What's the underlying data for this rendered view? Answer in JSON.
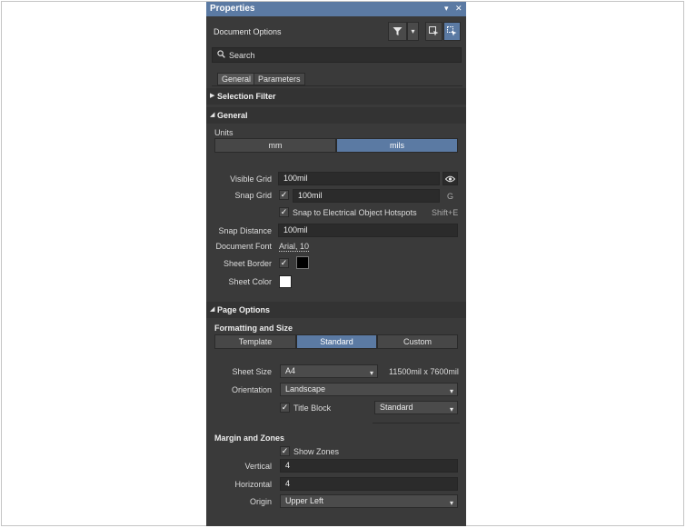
{
  "window": {
    "title": "Properties",
    "pin_icon": "pin-icon",
    "close_icon": "close-icon"
  },
  "header": {
    "subtitle": "Document Options"
  },
  "search": {
    "placeholder": "Search"
  },
  "tabs": [
    {
      "label": "General"
    },
    {
      "label": "Parameters"
    }
  ],
  "sections": {
    "selection_filter": "Selection Filter",
    "general": "General",
    "page_options": "Page Options"
  },
  "general": {
    "units_label": "Units",
    "units_options": [
      "mm",
      "mils"
    ],
    "units_selected": "mils",
    "visible_grid_label": "Visible Grid",
    "visible_grid_value": "100mil",
    "snap_grid_label": "Snap Grid",
    "snap_grid_checked": true,
    "snap_grid_value": "100mil",
    "snap_grid_shortcut": "G",
    "snap_hotspots_label": "Snap to Electrical Object Hotspots",
    "snap_hotspots_checked": true,
    "snap_hotspots_shortcut": "Shift+E",
    "snap_distance_label": "Snap Distance",
    "snap_distance_value": "100mil",
    "document_font_label": "Document Font",
    "document_font_value": "Arial, 10",
    "sheet_border_label": "Sheet Border",
    "sheet_border_checked": true,
    "sheet_border_color": "#000000",
    "sheet_color_label": "Sheet Color",
    "sheet_color": "#ffffff"
  },
  "page_options": {
    "formatting_label": "Formatting and Size",
    "format_options": [
      "Template",
      "Standard",
      "Custom"
    ],
    "format_selected": "Standard",
    "sheet_size_label": "Sheet Size",
    "sheet_size_value": "A4",
    "sheet_size_dims": "11500mil x 7600mil",
    "orientation_label": "Orientation",
    "orientation_value": "Landscape",
    "title_block_label": "Title Block",
    "title_block_checked": true,
    "title_block_value": "Standard",
    "margin_zones_label": "Margin and Zones",
    "show_zones_label": "Show Zones",
    "show_zones_checked": true,
    "vertical_label": "Vertical",
    "vertical_value": "4",
    "horizontal_label": "Horizontal",
    "horizontal_value": "4",
    "origin_label": "Origin",
    "origin_value": "Upper Left"
  },
  "colors": {
    "accent": "#5b7aa3",
    "panel_bg": "#3a3a3a",
    "field_bg": "#2b2b2b"
  },
  "glyphs": {
    "check": "✓",
    "caret_down": "▾",
    "collapsed": "▶",
    "expanded": "◢"
  }
}
